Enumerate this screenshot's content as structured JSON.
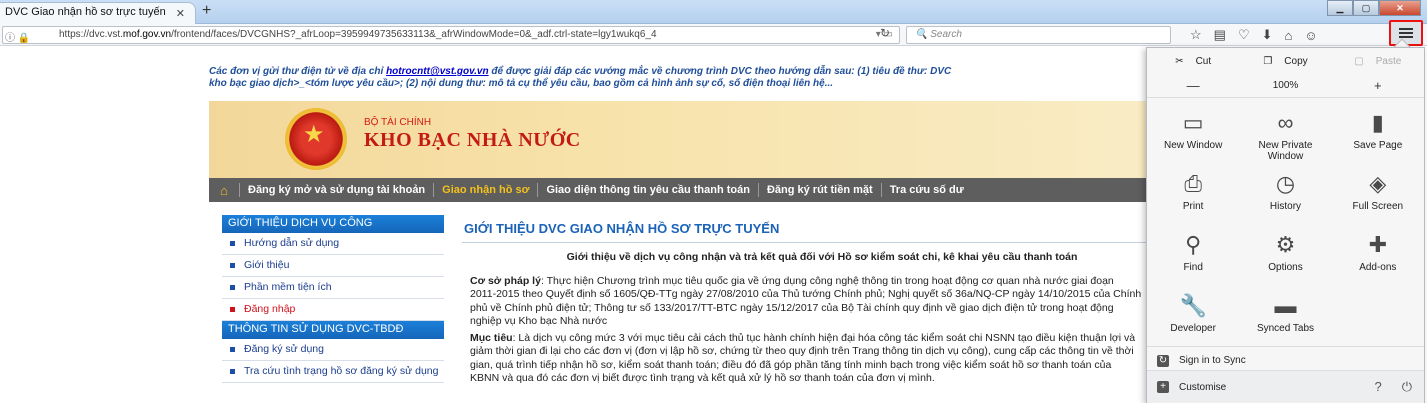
{
  "browser": {
    "tab_title": "DVC Giao nhận hồ sơ trực tuyến",
    "url_prefix": "https://dvc.vst.",
    "url_domain": "mof.gov.vn",
    "url_rest": "/frontend/faces/DVCGNHS?_afrLoop=3959949735633113&_afrWindowMode=0&_adf.ctrl-state=lgy1wukq6_4",
    "search_placeholder": "Search"
  },
  "page": {
    "notice_before": "Các đơn vị gửi thư điện tử về địa chỉ",
    "notice_email": "hotrocntt@vst.gov.vn",
    "notice_after": "để được giải đáp các vướng mắc về chương trình DVC theo hướng dẫn sau: (1) tiêu đề thư: DVC",
    "notice_line2": "kho bạc giao dịch>_<tóm lược yêu cầu>; (2) nội dung thư: mô tả cụ thể yêu cầu, bao gồm cả hình ảnh sự cố, số điện thoại liên hệ...",
    "ministry": "BỘ TÀI CHÍNH",
    "org": "KHO BẠC NHÀ NƯỚC",
    "nav": [
      "Đăng ký mở và sử dụng tài khoản",
      "Giao nhận hồ sơ",
      "Giao diện thông tin yêu cầu thanh toán",
      "Đăng ký rút tiền mặt",
      "Tra cứu số dư"
    ],
    "sidebar": {
      "head1": "GIỚI THIỆU DỊCH VỤ CÔNG",
      "items1": [
        "Hướng dẫn sử dụng",
        "Giới thiệu",
        "Phần mềm tiện ích",
        "Đăng nhập"
      ],
      "head2": "THÔNG TIN SỬ DỤNG DVC-TBDĐ",
      "items2": [
        "Đăng ký sử dụng",
        "Tra cứu tình trạng hồ sơ đăng ký sử dụng"
      ]
    },
    "content": {
      "title": "GIỚI THIỆU DVC GIAO NHẬN HỒ SƠ TRỰC TUYẾN",
      "subtitle": "Giới thiệu về dịch vụ công nhận và trả kết quả đối với Hồ sơ kiểm soát chi, kê khai yêu cầu thanh toán",
      "p1_label": "Cơ sở pháp lý",
      "p1_text": ": Thực hiện Chương trình mục tiêu quốc gia về ứng dụng công nghệ thông tin trong hoạt động cơ quan nhà nước giai đoạn 2011-2015 theo Quyết định số 1605/QĐ-TTg ngày 27/08/2010 của Thủ tướng Chính phủ; Nghị quyết số 36a/NQ-CP ngày 14/10/2015 của Chính phủ về Chính phủ điện tử; Thông tư số 133/2017/TT-BTC ngày 15/12/2017 của Bộ Tài chính quy định về giao dịch điện tử trong hoạt động nghiệp vụ Kho bạc Nhà nước",
      "p2_label": "Mục tiêu",
      "p2_text": ": Là dịch vụ công mức 3 với mục tiêu cải cách thủ tục hành chính hiện đại hóa công tác kiểm soát chi NSNN tạo điều kiện thuận lợi và giảm thời gian đi lại cho các đơn vị (đơn vị lập hồ sơ, chứng từ theo quy định trên Trang thông tin dịch vụ công), cung cấp các thông tin về thời gian, quá trình tiếp nhận hồ sơ, kiểm soát thanh toán; điều đó đã góp phần tăng tính minh bạch trong việc kiểm soát hồ sơ thanh toán của KBNN và qua đó các đơn vị biết được tình trạng và kết quả xử lý hồ sơ thanh toán của đơn vị mình."
    }
  },
  "menu": {
    "cut": "Cut",
    "copy": "Copy",
    "paste": "Paste",
    "zoom_out": "—",
    "zoom": "100%",
    "zoom_in": "+",
    "items": [
      {
        "label": "New Window",
        "icon": "new-window-icon"
      },
      {
        "label": "New Private Window",
        "icon": "private-mask-icon"
      },
      {
        "label": "Save Page",
        "icon": "save-page-icon"
      },
      {
        "label": "Print",
        "icon": "print-icon"
      },
      {
        "label": "History",
        "icon": "history-clock-icon"
      },
      {
        "label": "Full Screen",
        "icon": "full-screen-icon"
      },
      {
        "label": "Find",
        "icon": "find-magnifier-icon"
      },
      {
        "label": "Options",
        "icon": "options-gear-icon"
      },
      {
        "label": "Add-ons",
        "icon": "addons-puzzle-icon"
      },
      {
        "label": "Developer",
        "icon": "developer-wrench-icon"
      },
      {
        "label": "Synced Tabs",
        "icon": "synced-tabs-icon"
      }
    ],
    "sync": "Sign in to Sync",
    "customise": "Customise"
  },
  "colors": {
    "menu_highlight": "#ee1111",
    "nav_active": "#f4c21c",
    "sidebar_head": "#1b80d8",
    "title_blue": "#1b63b8"
  }
}
